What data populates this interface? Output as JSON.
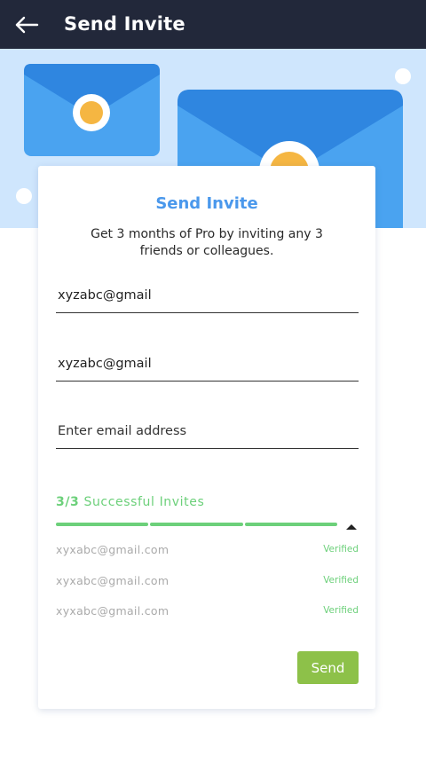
{
  "header": {
    "title": "Send Invite",
    "back_icon": "arrow-left-icon"
  },
  "hero": {
    "background": "#cfe6fd",
    "envelope_color": "#4aa3f0",
    "envelope_flap_color": "#2f86e0",
    "seal_color": "#f5b642"
  },
  "card": {
    "title": "Send Invite",
    "description": "Get 3 months of Pro by inviting any 3 friends or colleagues."
  },
  "fields": [
    {
      "value": "xyzabc@gmail",
      "placeholder": "Enter email address"
    },
    {
      "value": "xyzabc@gmail",
      "placeholder": "Enter email address"
    },
    {
      "value": "",
      "placeholder": "Enter email address"
    }
  ],
  "invites": {
    "count": "3/3",
    "label": "Successful Invites",
    "progress": 1.0,
    "accent": "#6cd07a",
    "list": [
      {
        "email": "xyxabc@gmail.com",
        "status": "Verified"
      },
      {
        "email": "xyxabc@gmail.com",
        "status": "Verified"
      },
      {
        "email": "xyxabc@gmail.com",
        "status": "Verified"
      }
    ]
  },
  "actions": {
    "send_label": "Send",
    "send_color": "#8dc149"
  }
}
